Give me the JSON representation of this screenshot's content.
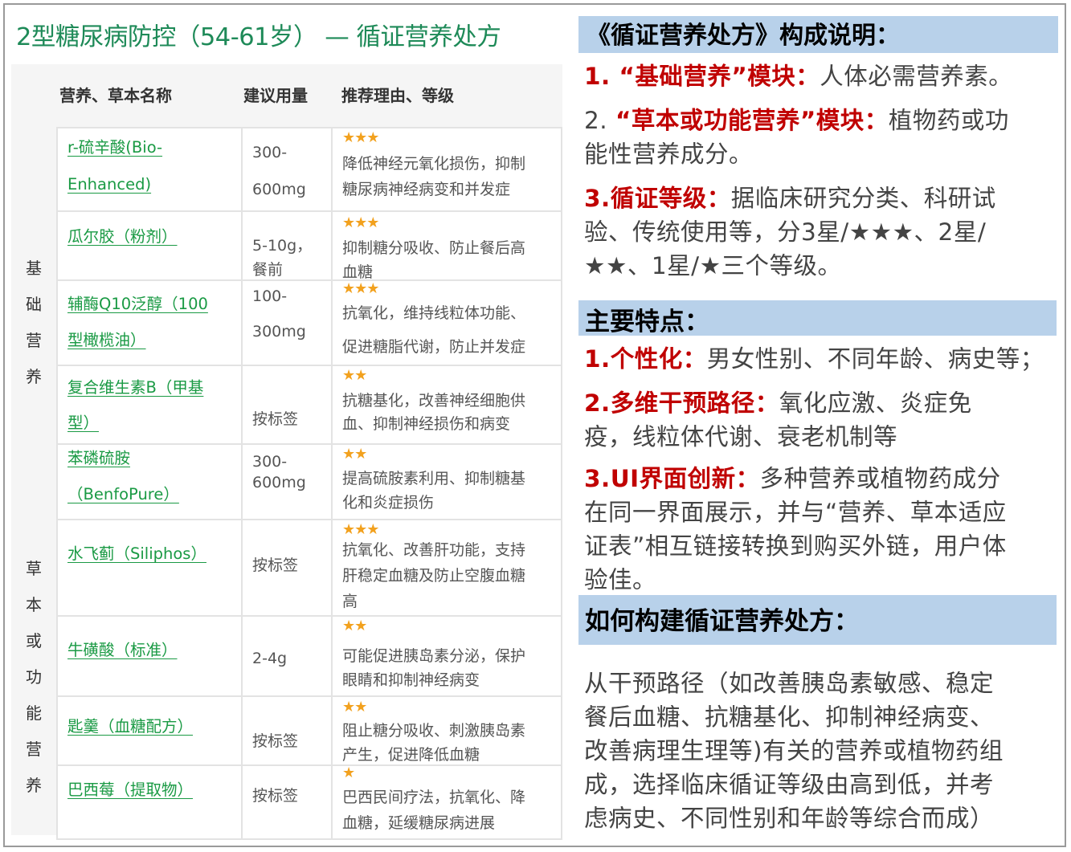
{
  "table": {
    "title": "2型糖尿病防控（54-61岁） — 循证营养处方",
    "headers": {
      "name": "营养、草本名称",
      "dose": "建议用量",
      "reason": "推荐理由、等级"
    },
    "groups": [
      {
        "label_chars": [
          "基",
          "础",
          "营",
          "养"
        ]
      },
      {
        "label_chars": [
          "草",
          "本",
          "或",
          "功",
          "能",
          "营",
          "养"
        ]
      }
    ],
    "rows": [
      {
        "name_lines": [
          "r-硫辛酸(Bio-",
          "Enhanced)"
        ],
        "dose_lines": [
          "300-",
          "600mg"
        ],
        "stars": "★★★",
        "reason_lines": [
          "降低神经元氧化损伤，抑制",
          "糖尿病神经病变和并发症"
        ]
      },
      {
        "name_lines": [
          "瓜尔胶（粉剂）"
        ],
        "dose_lines": [
          "5-10g，",
          "餐前"
        ],
        "stars": "★★★",
        "reason_lines": [
          "抑制糖分吸收、防止餐后高",
          "血糖"
        ]
      },
      {
        "name_lines": [
          "辅酶Q10泛醇（100",
          "型橄榄油）"
        ],
        "dose_lines": [
          "100-",
          "300mg"
        ],
        "stars": "★★★",
        "reason_lines": [
          "抗氧化，维持线粒体功能、",
          "促进糖脂代谢，防止并发症"
        ]
      },
      {
        "name_lines": [
          "复合维生素B（甲基",
          "型）"
        ],
        "dose_lines": [
          "按标签"
        ],
        "stars": "★★",
        "reason_lines": [
          "抗糖基化，改善神经细胞供",
          "血、抑制神经损伤和病变"
        ]
      },
      {
        "name_lines": [
          "苯磷硫胺",
          "（BenfoPure）"
        ],
        "dose_lines": [
          "300-",
          "600mg"
        ],
        "stars": "★★",
        "reason_lines": [
          "提高硫胺素利用、抑制糖基",
          "化和炎症损伤"
        ]
      },
      {
        "name_lines": [
          "水飞蓟（Siliphos）"
        ],
        "dose_lines": [
          "按标签"
        ],
        "stars": "★★★",
        "reason_lines": [
          "抗氧化、改善肝功能，支持",
          "肝稳定血糖及防止空腹血糖",
          "高"
        ]
      },
      {
        "name_lines": [
          "牛磺酸（标准）"
        ],
        "dose_lines": [
          "2-4g"
        ],
        "stars": "★★",
        "reason_lines": [
          "可能促进胰岛素分泌，保护",
          "眼睛和抑制神经病变"
        ]
      },
      {
        "name_lines": [
          "匙羹（血糖配方）"
        ],
        "dose_lines": [
          "按标签"
        ],
        "stars": "★★",
        "reason_lines": [
          "阻止糖分吸收、刺激胰岛素",
          "产生，促进降低血糖"
        ]
      },
      {
        "name_lines": [
          "巴西莓（提取物）"
        ],
        "dose_lines": [
          "按标签"
        ],
        "stars": "★",
        "reason_lines": [
          "巴西民间疗法，抗氧化、降",
          "血糖，延缓糖尿病进展"
        ]
      }
    ]
  },
  "panel": {
    "section1": {
      "header": "《循证营养处方》构成说明：",
      "item1": {
        "label": "1. “基础营养”模块：",
        "text": [
          "人体必需营养素。"
        ]
      },
      "item2": {
        "number": "2. ",
        "label": "“草本或功能营养”模块：",
        "text": [
          "植物药或功",
          "能性营养成分。"
        ]
      },
      "item3": {
        "label": "3.循证等级：",
        "text": [
          "据临床研究分类、科研试",
          "验、传统使用等，分3星/★★★、2星/",
          "★★、1星/★三个等级。"
        ]
      }
    },
    "section2": {
      "header": "主要特点：",
      "item1": {
        "label": "1.个性化：",
        "text": [
          "男女性别、不同年龄、病史等；"
        ]
      },
      "item2": {
        "label": "2.多维干预路径：",
        "text": [
          "氧化应激、炎症免",
          "疫，线粒体代谢、衰老机制等"
        ]
      },
      "item3": {
        "label": "3.UI界面创新：",
        "text": [
          "多种营养或植物药成分",
          "在同一界面展示，并与“营养、草本适应",
          "证表”相互链接转换到购买外链，用户体",
          "验佳。"
        ]
      }
    },
    "section3": {
      "header": "如何构建循证营养处方：",
      "text": [
        "从干预路径（如改善胰岛素敏感、稳定",
        "餐后血糖、抗糖基化、抑制神经病变、",
        "改善病理生理等)有关的营养或植物药组",
        "成，选择临床循证等级由高到低，并考",
        "虑病史、不同性别和年龄等综合而成）"
      ]
    }
  }
}
